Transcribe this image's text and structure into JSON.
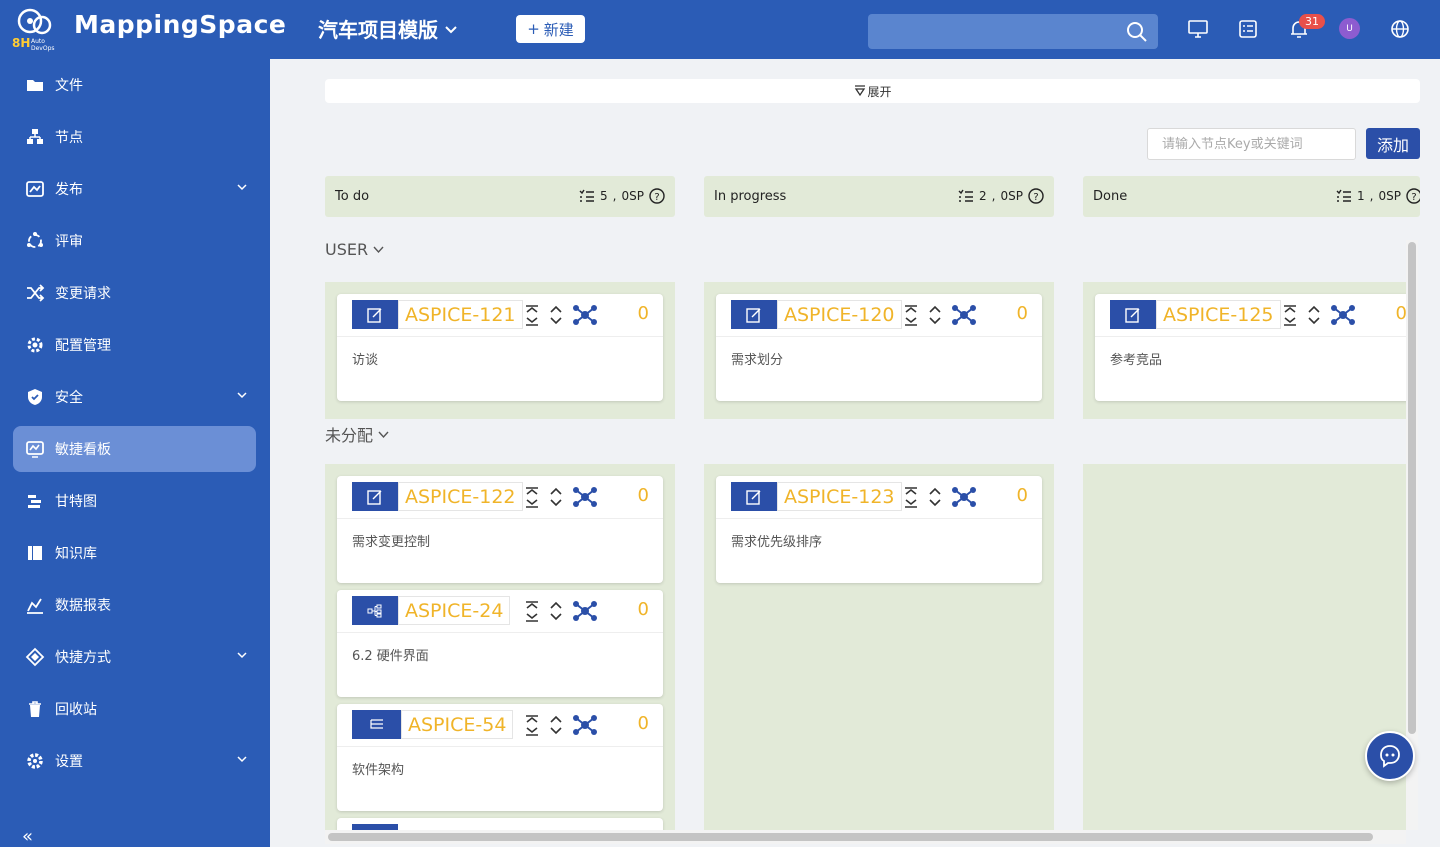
{
  "app": {
    "name": "MappingSpace",
    "logo_sub": "8H",
    "logo_caption": "Auto DevOps"
  },
  "header": {
    "project": "汽车项目模版",
    "new_label": "新建",
    "notification_count": "31",
    "avatar_initial": "U"
  },
  "sidebar": {
    "items": [
      {
        "label": "文件",
        "icon": "folder-icon"
      },
      {
        "label": "节点",
        "icon": "hierarchy-icon"
      },
      {
        "label": "发布",
        "icon": "release-icon"
      },
      {
        "label": "评审",
        "icon": "review-icon"
      },
      {
        "label": "变更请求",
        "icon": "shuffle-icon"
      },
      {
        "label": "配置管理",
        "icon": "config-icon"
      },
      {
        "label": "安全",
        "icon": "shield-icon"
      },
      {
        "label": "敏捷看板",
        "icon": "board-icon"
      },
      {
        "label": "甘特图",
        "icon": "gantt-icon"
      },
      {
        "label": "知识库",
        "icon": "book-icon"
      },
      {
        "label": "数据报表",
        "icon": "chart-icon"
      },
      {
        "label": "快捷方式",
        "icon": "shortcut-icon"
      },
      {
        "label": "回收站",
        "icon": "trash-icon"
      },
      {
        "label": "设置",
        "icon": "gear-icon"
      }
    ],
    "collapse_label": "«"
  },
  "toolbar": {
    "expand_label": "展开",
    "key_placeholder": "请输入节点Key或关键词",
    "add_label": "添加"
  },
  "columns": [
    {
      "name": "To do",
      "count": "5",
      "sp": "0SP"
    },
    {
      "name": "In progress",
      "count": "2",
      "sp": "0SP"
    },
    {
      "name": "Done",
      "count": "1",
      "sp": "0SP"
    }
  ],
  "groups": [
    {
      "label": "USER",
      "cards": [
        {
          "key": "ASPICE-121",
          "title": "访谈",
          "count": "0"
        },
        {
          "key": "ASPICE-120",
          "title": "需求划分",
          "count": "0"
        },
        {
          "key": "ASPICE-125",
          "title": "参考竞品",
          "count": "0"
        }
      ]
    },
    {
      "label": "未分配",
      "cards": [
        {
          "key": "ASPICE-122",
          "title": "需求变更控制",
          "count": "0"
        },
        {
          "key": "ASPICE-24",
          "title": "6.2 硬件界面",
          "count": "0"
        },
        {
          "key": "ASPICE-54",
          "title": "软件架构",
          "count": "0"
        },
        {
          "key": "ASPICE-123",
          "title": "需求优先级排序",
          "count": "0"
        }
      ]
    }
  ],
  "colors": {
    "brand": "#2b5cb6",
    "accent": "#f0b429",
    "lane": "#e2ead8"
  }
}
